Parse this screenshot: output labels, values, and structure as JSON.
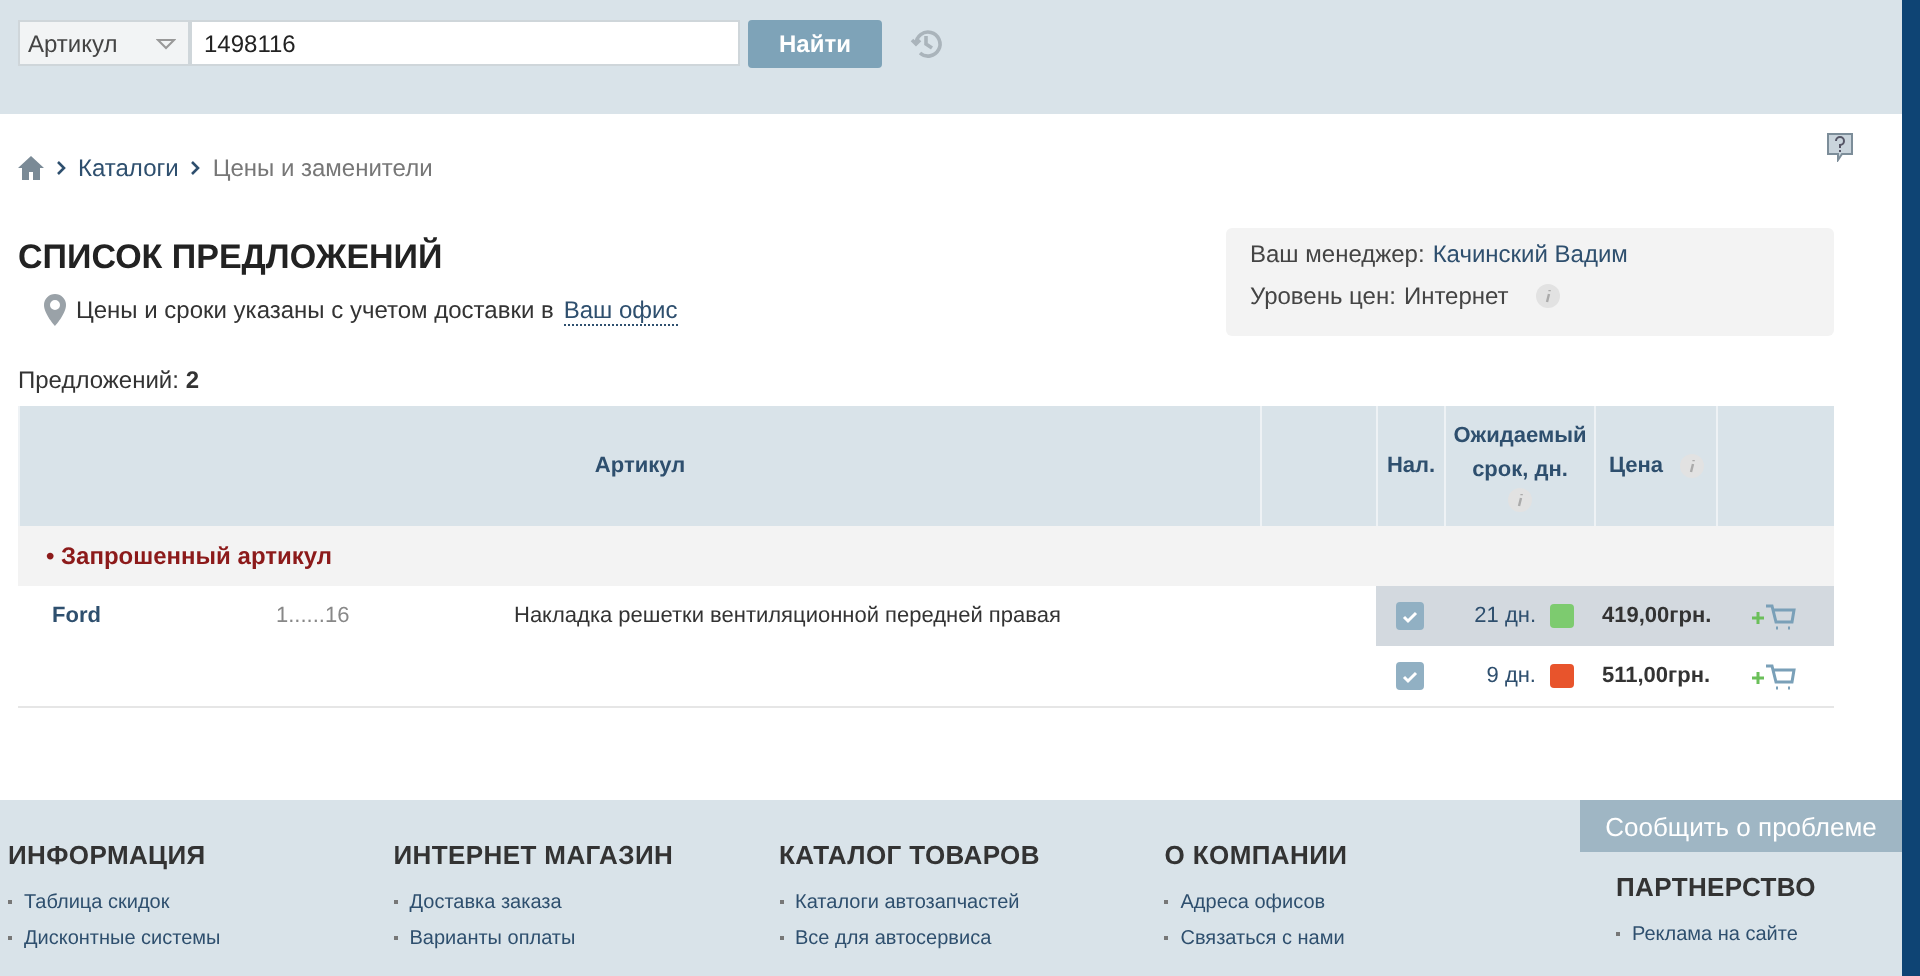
{
  "search": {
    "type_select": "Артикул",
    "value": "1498116",
    "button": "Найти"
  },
  "breadcrumbs": [
    {
      "label": "Каталоги",
      "current": false
    },
    {
      "label": "Цены и заменители",
      "current": true
    }
  ],
  "title": "СПИСОК ПРЕДЛОЖЕНИЙ",
  "delivery_note": {
    "text": "Цены и сроки указаны с учетом доставки в",
    "link": "Ваш офис"
  },
  "manager": {
    "label": "Ваш менеджер:",
    "name": "Качинский Вадим",
    "price_level_label": "Уровень цен:",
    "price_level": "Интернет"
  },
  "offers_count": {
    "label": "Предложений:",
    "value": "2"
  },
  "table": {
    "columns": {
      "article": "Артикул",
      "stock": "Нал.",
      "term": "Ожидаемый срок, дн.",
      "price": "Цена"
    },
    "group": "• Запрошенный артикул",
    "item": {
      "brand": "Ford",
      "article": "1......16",
      "description": "Накладка решетки вентиляционной передней правая"
    },
    "offers": [
      {
        "in_stock": true,
        "term": "21 дн.",
        "color": "#7dcb6f",
        "price": "419,00грн.",
        "selected": true
      },
      {
        "in_stock": true,
        "term": "9 дн.",
        "color": "#e8542c",
        "price": "511,00грн.",
        "selected": false
      }
    ]
  },
  "footer": {
    "report_button": "Сообщить о проблеме",
    "columns": [
      {
        "title": "ИНФОРМАЦИЯ",
        "links": [
          "Таблица скидок",
          "Дисконтные системы"
        ]
      },
      {
        "title": "ИНТЕРНЕТ МАГАЗИН",
        "links": [
          "Доставка заказа",
          "Варианты оплаты"
        ]
      },
      {
        "title": "КАТАЛОГ ТОВАРОВ",
        "links": [
          "Каталоги автозапчастей",
          "Все для автосервиса"
        ]
      },
      {
        "title": "О КОМПАНИИ",
        "links": [
          "Адреса офисов",
          "Связаться с нами"
        ]
      },
      {
        "title": "ПАРТНЕРСТВО",
        "links": [
          "Реклама на сайте"
        ]
      }
    ]
  }
}
